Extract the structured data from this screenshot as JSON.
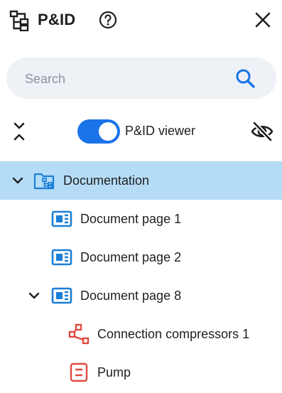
{
  "header": {
    "title": "P&ID",
    "app_icon": "hierarchy-icon",
    "help_icon": "help-circle-icon",
    "close_icon": "close-icon"
  },
  "search": {
    "placeholder": "Search",
    "value": "",
    "icon": "search-icon"
  },
  "toolbar": {
    "collapse_icon": "collapse-all-icon",
    "toggle_label": "P&ID viewer",
    "toggle_on": true,
    "visibility_icon": "eye-off-icon"
  },
  "colors": {
    "accent": "#1a73e8",
    "selected_bg": "#b5dcf6",
    "document_icon": "#1a7fd6",
    "connection_icon": "#e04a3f",
    "equipment_icon": "#e04a3f",
    "search_bg": "#eef1f5"
  },
  "tree": [
    {
      "label": "Documentation",
      "icon": "folder-hierarchy-icon",
      "expanded": true,
      "selected": true
    },
    {
      "label": "Document page 1",
      "icon": "document-page-icon"
    },
    {
      "label": "Document page 2",
      "icon": "document-page-icon"
    },
    {
      "label": "Document page 8",
      "icon": "document-page-icon",
      "expanded": true
    },
    {
      "label": "Connection compressors 1",
      "icon": "connection-icon"
    },
    {
      "label": "Pump",
      "icon": "equipment-icon"
    }
  ]
}
